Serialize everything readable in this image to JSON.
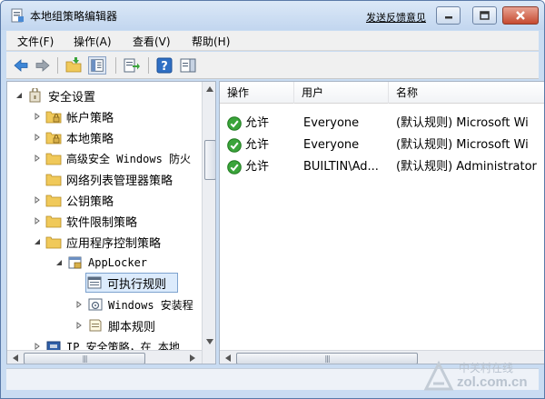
{
  "window": {
    "title": "本地组策略编辑器",
    "feedback_link": "发送反馈意见"
  },
  "menu": {
    "items": [
      "文件(F)",
      "操作(A)",
      "查看(V)",
      "帮助(H)"
    ]
  },
  "toolbar": {
    "icons": [
      "back-arrow-icon",
      "forward-arrow-icon",
      "up-folder-icon",
      "show-hide-tree-icon",
      "export-list-icon",
      "help-icon",
      "show-action-pane-icon"
    ]
  },
  "tree": {
    "root": "安全设置",
    "items": [
      "帐户策略",
      "本地策略",
      "高级安全 Windows 防火",
      "网络列表管理器策略",
      "公钥策略",
      "软件限制策略",
      "应用程序控制策略",
      "AppLocker",
      "可执行规则",
      "Windows 安装程",
      "脚本规则",
      "IP 安全策略，在 本地"
    ]
  },
  "list": {
    "columns": [
      "操作",
      "用户",
      "名称"
    ],
    "rows": [
      {
        "action": "允许",
        "user": "Everyone",
        "name": "(默认规则) Microsoft Wi"
      },
      {
        "action": "允许",
        "user": "Everyone",
        "name": "(默认规则) Microsoft Wi"
      },
      {
        "action": "允许",
        "user": "BUILTIN\\Ad...",
        "name": "(默认规则) Administrator"
      }
    ]
  },
  "watermark": {
    "cn": "中关村在线",
    "en": "zol.com.cn"
  },
  "colors": {
    "allow_green": "#3aa43a",
    "selected_bg": "#dcebfc",
    "folder": "#f0c95a"
  }
}
